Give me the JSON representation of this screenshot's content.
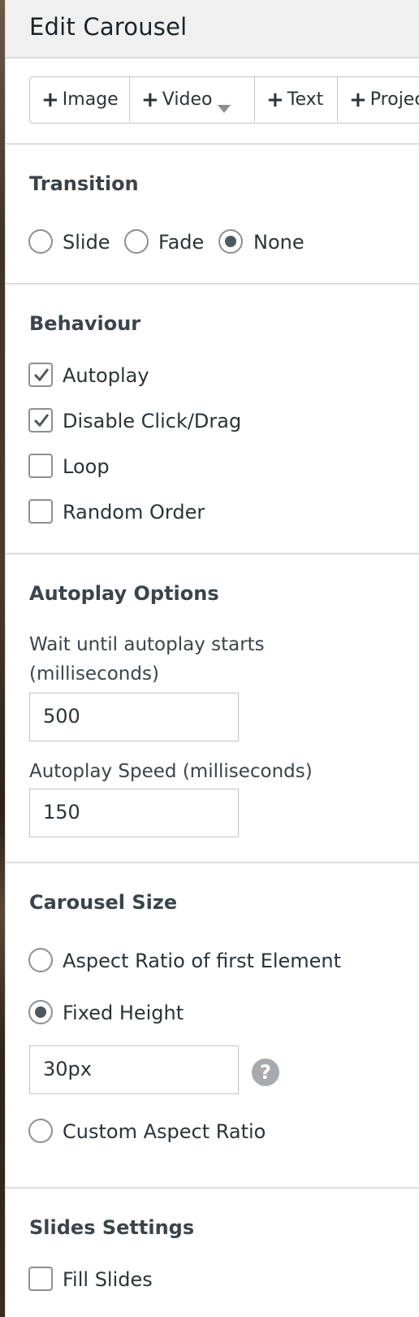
{
  "header": {
    "title": "Edit Carousel"
  },
  "toolbar": {
    "buttons": [
      {
        "label": "Image",
        "icon": "plus-icon"
      },
      {
        "label": "Video",
        "icon": "plus-icon",
        "dropdown": true
      },
      {
        "label": "Text",
        "icon": "plus-icon"
      },
      {
        "label": "Project",
        "icon": "plus-icon"
      }
    ]
  },
  "transition": {
    "title": "Transition",
    "options": [
      "Slide",
      "Fade",
      "None"
    ],
    "selected": "None"
  },
  "behaviour": {
    "title": "Behaviour",
    "options": [
      {
        "label": "Autoplay",
        "checked": true
      },
      {
        "label": "Disable Click/Drag",
        "checked": true
      },
      {
        "label": "Loop",
        "checked": false
      },
      {
        "label": "Random Order",
        "checked": false
      }
    ]
  },
  "autoplay": {
    "title": "Autoplay Options",
    "wait_label_line1": "Wait until autoplay starts",
    "wait_label_line2": "(milliseconds)",
    "wait_value": "500",
    "speed_label": "Autoplay Speed (milliseconds)",
    "speed_value": "150"
  },
  "carousel_size": {
    "title": "Carousel Size",
    "options": [
      "Aspect Ratio of first Element",
      "Fixed Height",
      "Custom Aspect Ratio"
    ],
    "selected": "Fixed Height",
    "height_value": "30px",
    "help_icon": "?"
  },
  "slides_settings": {
    "title": "Slides Settings",
    "fill_slides_label": "Fill Slides",
    "fill_slides_checked": false
  },
  "colors": {
    "accent_gray": "#50575e",
    "border": "#dcdcde",
    "header_bg": "#f0f0f1"
  }
}
